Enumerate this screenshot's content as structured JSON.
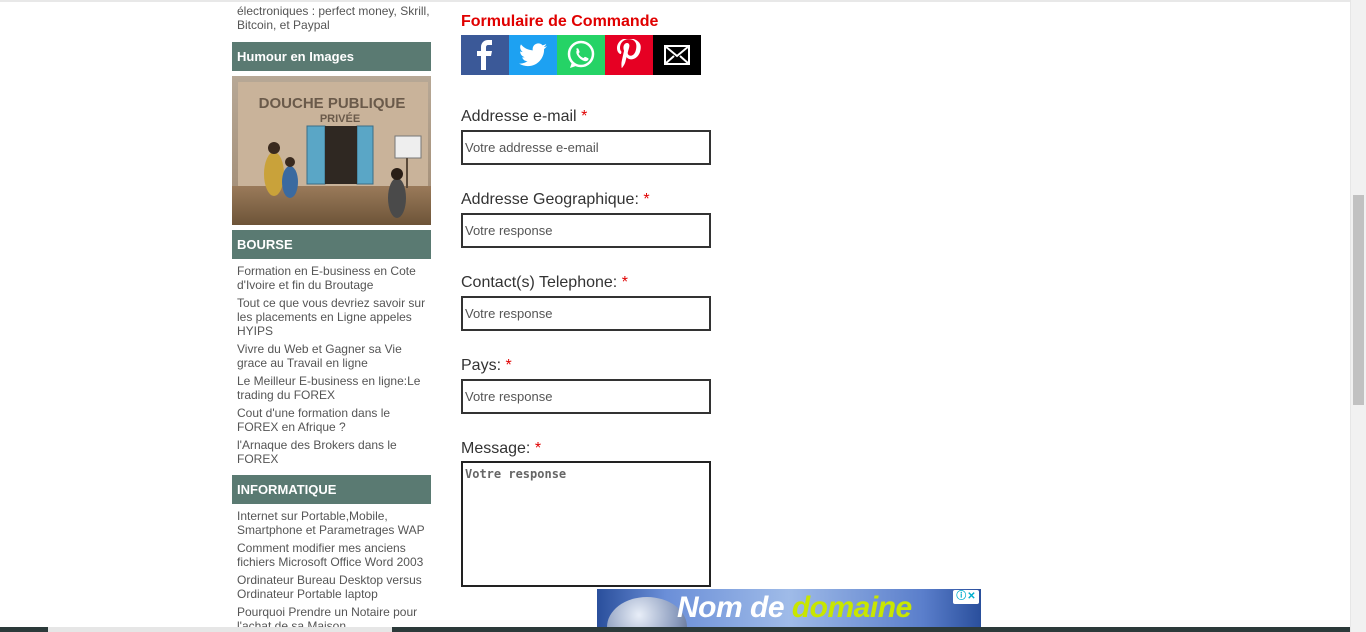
{
  "sidebar": {
    "intro_text": "électroniques : perfect money, Skrill, Bitcoin, et Paypal",
    "humour": {
      "title": "Humour en Images",
      "image_sign_main": "DOUCHE PUBLIQUE",
      "image_sign_sub": "PRIVÉE"
    },
    "bourse": {
      "title": "BOURSE",
      "links": [
        "Formation en E-business en Cote d'Ivoire et fin du Broutage",
        "Tout ce que vous devriez savoir sur les placements en Ligne appeles HYIPS",
        "Vivre du Web et Gagner sa Vie grace au Travail en ligne",
        "Le Meilleur E-business en ligne:Le trading du FOREX",
        "Cout d'une formation dans le FOREX en Afrique ?",
        "l'Arnaque des Brokers dans le FOREX"
      ]
    },
    "informatique": {
      "title": "INFORMATIQUE",
      "links": [
        "Internet sur Portable,Mobile, Smartphone et Parametrages WAP",
        "Comment modifier mes anciens fichiers Microsoft Office Word 2003",
        "Ordinateur Bureau Desktop versus Ordinateur Portable laptop",
        "Pourquoi Prendre un Notaire pour l'achat de sa Maison"
      ]
    }
  },
  "form": {
    "title": "Formulaire de Commande",
    "share": [
      {
        "icon": "facebook-icon",
        "color": "#3b5998"
      },
      {
        "icon": "twitter-icon",
        "color": "#1da1f2"
      },
      {
        "icon": "whatsapp-icon",
        "color": "#25d366"
      },
      {
        "icon": "pinterest-icon",
        "color": "#e60023"
      },
      {
        "icon": "email-icon",
        "color": "#000000"
      }
    ],
    "fields": {
      "email": {
        "label": "Addresse e-mail",
        "placeholder": "Votre addresse e-email",
        "required": "*"
      },
      "address": {
        "label": "Addresse Geographique:",
        "placeholder": "Votre response",
        "required": "*"
      },
      "phone": {
        "label": "Contact(s) Telephone:",
        "placeholder": "Votre response",
        "required": "*"
      },
      "country": {
        "label": "Pays:",
        "placeholder": "Votre response",
        "required": "*"
      },
      "message": {
        "label": "Message:",
        "placeholder": "Votre response",
        "required": "*"
      }
    }
  },
  "ad": {
    "word1": "Nom de",
    "word2": "domaine",
    "adchoices_icon": "adchoices-icon",
    "close_icon": "close-icon"
  },
  "colors": {
    "widget_header": "#5a7a72",
    "title_red": "#e00000"
  }
}
